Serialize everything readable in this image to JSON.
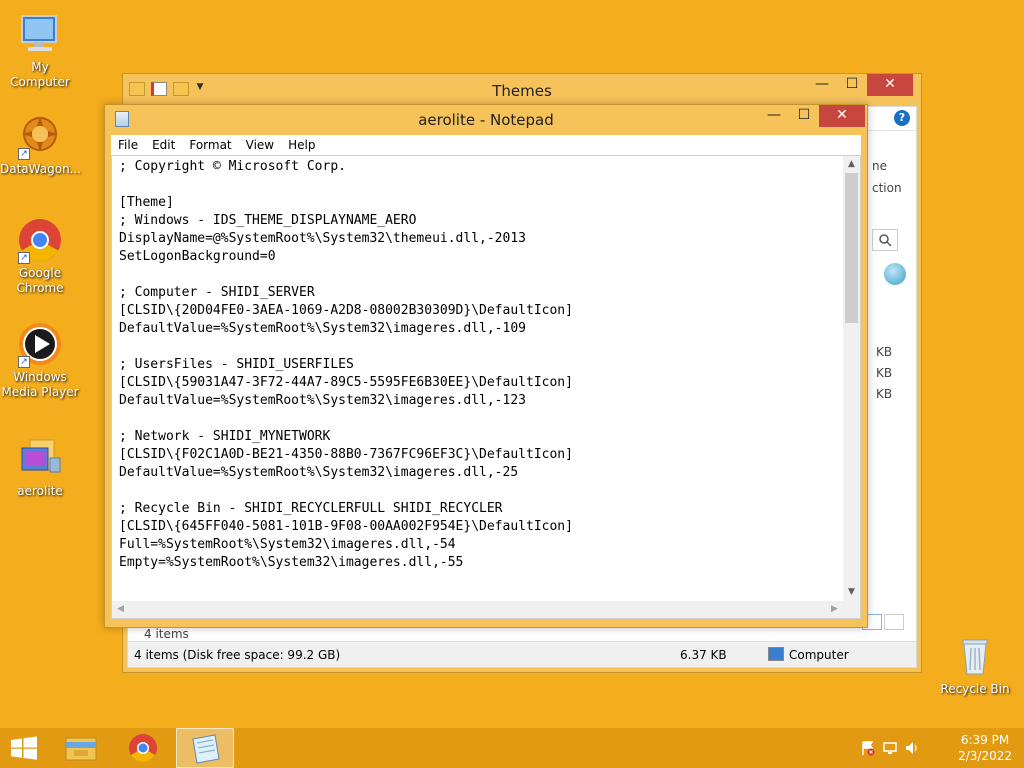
{
  "desktop": {
    "icons": [
      {
        "label": "My Computer"
      },
      {
        "label": "DataWagon..."
      },
      {
        "label": "Google Chrome"
      },
      {
        "label": "Windows Media Player"
      },
      {
        "label": "aerolite"
      },
      {
        "label": "Recycle Bin"
      }
    ]
  },
  "explorer": {
    "title": "Themes",
    "side_text_1": "ne",
    "side_text_2": "ction",
    "sizes": [
      "KB",
      "KB",
      "KB"
    ],
    "items_count": "4 items",
    "status_left": "4 items (Disk free space: 99.2 GB)",
    "status_size": "6.37 KB",
    "status_location": "Computer"
  },
  "notepad": {
    "title": "aerolite - Notepad",
    "menu": [
      "File",
      "Edit",
      "Format",
      "View",
      "Help"
    ],
    "lines": [
      "; Copyright © Microsoft Corp.",
      "",
      "[Theme]",
      "; Windows - IDS_THEME_DISPLAYNAME_AERO",
      "DisplayName=@%SystemRoot%\\System32\\themeui.dll,-2013",
      "SetLogonBackground=0",
      "",
      "; Computer - SHIDI_SERVER",
      "[CLSID\\{20D04FE0-3AEA-1069-A2D8-08002B30309D}\\DefaultIcon]",
      "DefaultValue=%SystemRoot%\\System32\\imageres.dll,-109",
      "",
      "; UsersFiles - SHIDI_USERFILES",
      "[CLSID\\{59031A47-3F72-44A7-89C5-5595FE6B30EE}\\DefaultIcon]",
      "DefaultValue=%SystemRoot%\\System32\\imageres.dll,-123",
      "",
      "; Network - SHIDI_MYNETWORK",
      "[CLSID\\{F02C1A0D-BE21-4350-88B0-7367FC96EF3C}\\DefaultIcon]",
      "DefaultValue=%SystemRoot%\\System32\\imageres.dll,-25",
      "",
      "; Recycle Bin - SHIDI_RECYCLERFULL SHIDI_RECYCLER",
      "[CLSID\\{645FF040-5081-101B-9F08-00AA002F954E}\\DefaultIcon]",
      "Full=%SystemRoot%\\System32\\imageres.dll,-54",
      "Empty=%SystemRoot%\\System32\\imageres.dll,-55"
    ]
  },
  "window_controls": {
    "minimize": "—",
    "maximize": "☐",
    "close": "✕"
  },
  "taskbar": {
    "time": "6:39 PM",
    "date": "2/3/2022"
  },
  "colors": {
    "desktop": "#f4ad1d",
    "window_frame": "#f6c35b",
    "close_button": "#c7463d",
    "taskbar": "#e39a13"
  }
}
